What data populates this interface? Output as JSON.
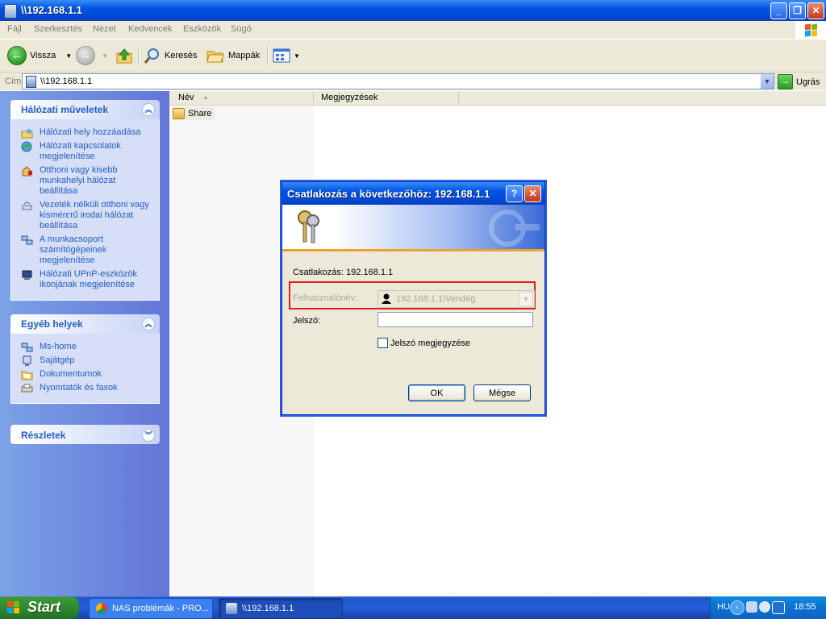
{
  "window": {
    "title": "\\\\192.168.1.1",
    "controls": {
      "minimize": "_",
      "restore": "❐",
      "close": "✕"
    }
  },
  "menu": [
    "Fájl",
    "Szerkesztés",
    "Nézet",
    "Kedvencek",
    "Eszközök",
    "Súgó"
  ],
  "toolbar": {
    "back_label": "Vissza",
    "search_label": "Keresés",
    "folders_label": "Mappák"
  },
  "address": {
    "label": "Cím",
    "value": "\\\\192.168.1.1",
    "go_label": "Ugrás"
  },
  "taskpane": {
    "network_tasks": {
      "title": "Hálózati műveletek",
      "items": [
        "Hálózati hely hozzáadása",
        "Hálózati kapcsolatok megjelenítése",
        "Otthoni vagy kisebb munkahelyi hálózat beállítása",
        "Vezeték nélküli otthoni vagy kismérετű irodai hálózat beállítása",
        "A munkacsoport számítógépeinek megjelenítése",
        "Hálózati UPnP-eszközök ikonjának megjelenítése"
      ]
    },
    "other_places": {
      "title": "Egyéb helyek",
      "items": [
        "Ms-home",
        "Sajátgép",
        "Dokumentumok",
        "Nyomtatók és faxok"
      ]
    },
    "details": {
      "title": "Részletek"
    }
  },
  "content": {
    "columns": [
      "Név",
      "Megjegyzések"
    ],
    "rows": [
      {
        "name": "Share"
      }
    ]
  },
  "dialog": {
    "title": "Csatlakozás a következőhöz: 192.168.1.1",
    "help": "?",
    "close": "✕",
    "connect_text": "Csatlakozás: 192.168.1.1",
    "username_label": "Felhasználónév:",
    "username_value": "192.168.1.1\\Vendég",
    "password_label": "Jelszó:",
    "password_value": "",
    "remember_label": "Jelszó megjegyzése",
    "remember_checked": false,
    "ok_label": "OK",
    "cancel_label": "Mégse"
  },
  "taskbar": {
    "start_label": "Start",
    "buttons": [
      "NAS problémák - PRO...",
      "\\\\192.168.1.1"
    ],
    "language": "HU",
    "clock": "18:55"
  }
}
